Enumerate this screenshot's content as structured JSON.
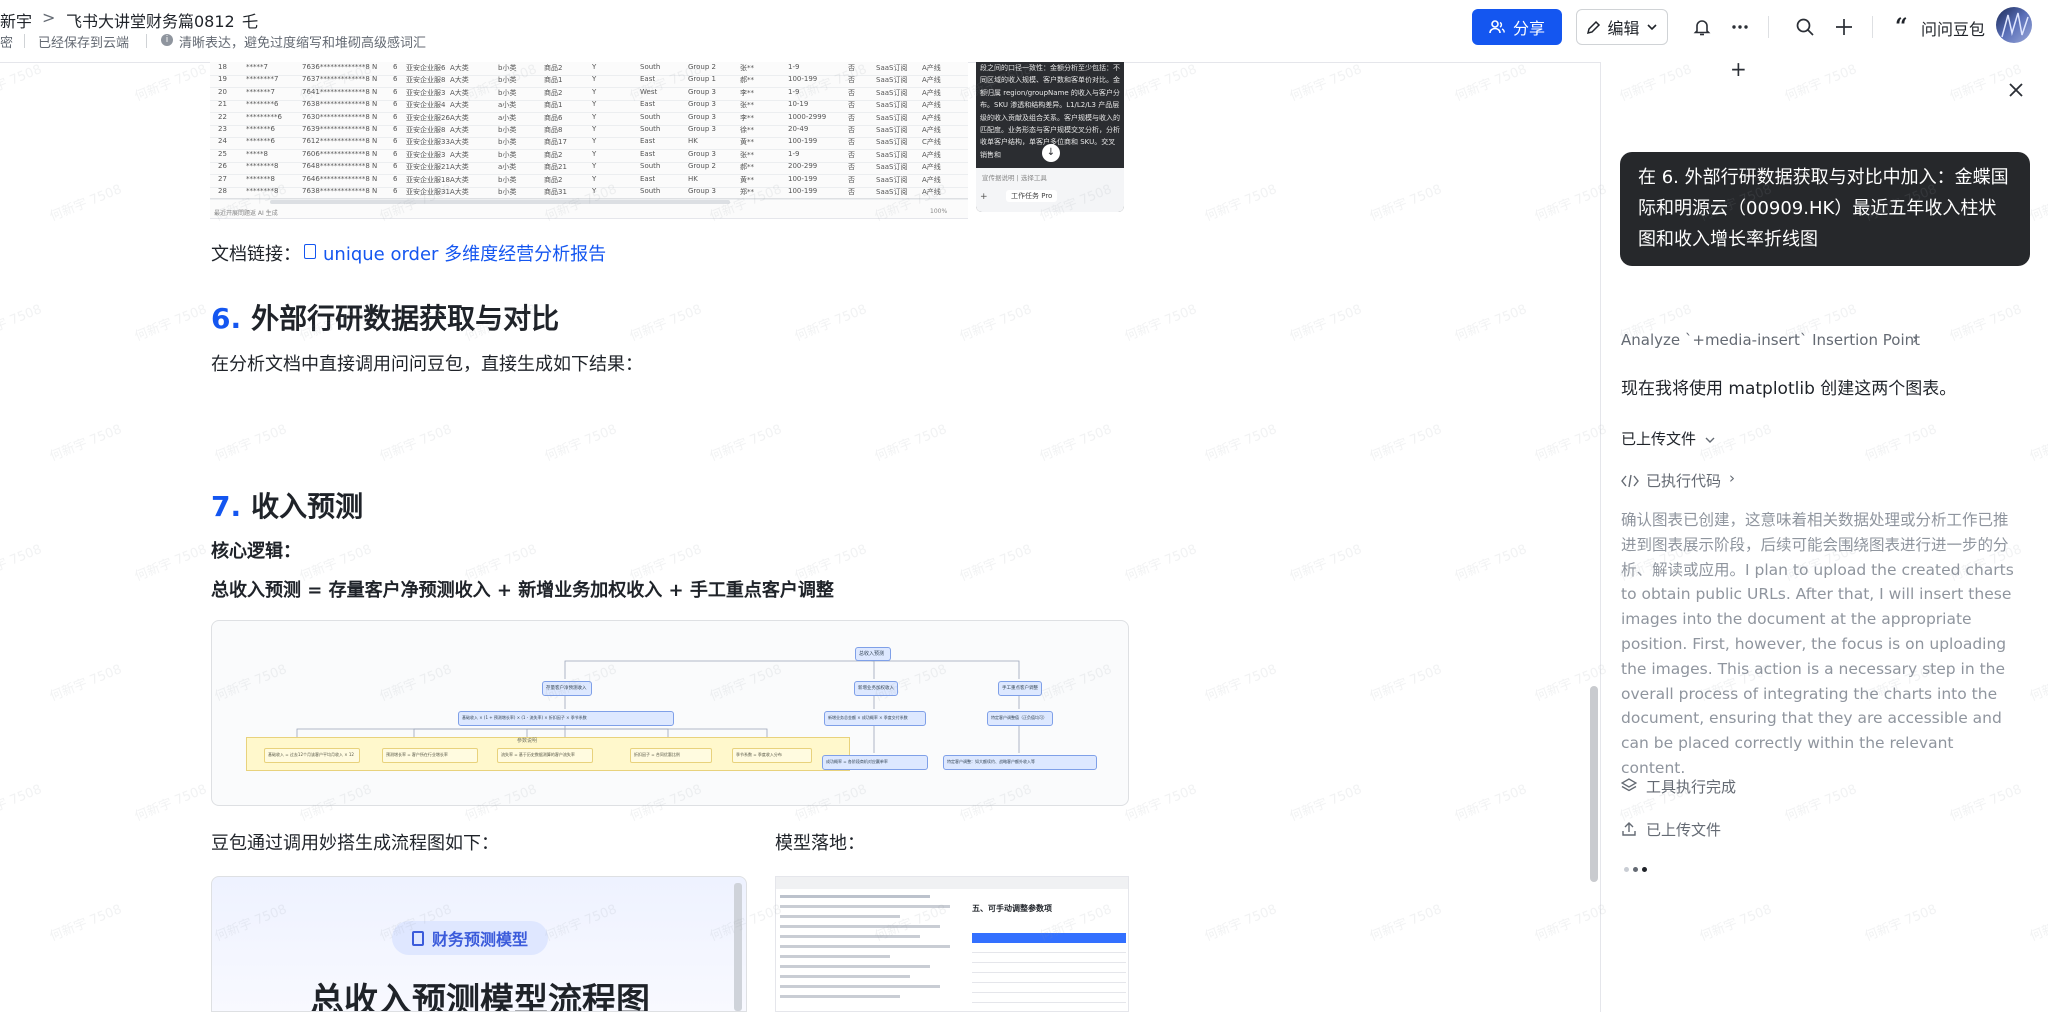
{
  "header": {
    "author": "新宇",
    "breadcrumb_sep": ">",
    "title": "飞书大讲堂财务篇0812",
    "pin_glyph": "乇",
    "sub_left": "密",
    "saved_status": "已经保存到云端",
    "tip_text": "清晰表达，避免过度缩写和堆砌高级感词汇",
    "share_label": "分享",
    "edit_label": "编辑",
    "ask_label": "问问豆包"
  },
  "document": {
    "link_prefix": "文档链接：",
    "link_text": "unique order 多维度经营分析报告",
    "section6_num": "6.",
    "section6_title": "外部行研数据获取与对比",
    "section6_body": "在分析文档中直接调用问问豆包，直接生成如下结果：",
    "section7_num": "7.",
    "section7_title": "收入预测",
    "core_logic_label": "核心逻辑：",
    "formula": "总收入预测 = 存量客户净预测收入 + 新增业务加权收入 + 手工重点客户调整",
    "caption_left": "豆包通过调用妙搭生成流程图如下：",
    "caption_right": "模型落地：",
    "card_badge": "财务预测模型",
    "card_title": "总收入预测模型流程图",
    "model_heading": "五、可手动调整参数项"
  },
  "sheet": {
    "rows": [
      [
        "18",
        "*****7",
        "7636*************8 N",
        "6",
        "亚安企业服6",
        "A大类",
        "b小类",
        "商品2",
        "Y",
        "South",
        "Group 2",
        "张**",
        "1-9",
        "否",
        "SaaS订阅",
        "A产线"
      ],
      [
        "19",
        "********7",
        "7637*************8 N",
        "6",
        "亚安企业服8",
        "A大类",
        "b小类",
        "商品1",
        "Y",
        "East",
        "Group 1",
        "郝**",
        "100-199",
        "否",
        "SaaS订阅",
        "A产线"
      ],
      [
        "20",
        "*******7",
        "7641*************8 N",
        "6",
        "亚安企业服3",
        "A大类",
        "b小类",
        "商品2",
        "Y",
        "West",
        "Group 3",
        "李**",
        "1-9",
        "否",
        "SaaS订阅",
        "A产线"
      ],
      [
        "21",
        "********6",
        "7638*************8 N",
        "6",
        "亚安企业服4",
        "A大类",
        "a小类",
        "商品1",
        "Y",
        "East",
        "Group 3",
        "张**",
        "10-19",
        "否",
        "SaaS订阅",
        "A产线"
      ],
      [
        "22",
        "*********6",
        "7630*************8 N",
        "6",
        "亚安企业服26",
        "A大类",
        "a小类",
        "商品6",
        "Y",
        "South",
        "Group 3",
        "李**",
        "1000-2999",
        "否",
        "SaaS订阅",
        "A产线"
      ],
      [
        "23",
        "*******6",
        "7639*************8 N",
        "6",
        "亚安企业服8",
        "A大类",
        "b小类",
        "商品8",
        "Y",
        "South",
        "Group 3",
        "徐**",
        "20-49",
        "否",
        "SaaS订阅",
        "A产线"
      ],
      [
        "24",
        "*******6",
        "7612*************8 N",
        "6",
        "亚安企业服33",
        "A大类",
        "b小类",
        "商品17",
        "Y",
        "East",
        "HK",
        "黄**",
        "100-199",
        "否",
        "SaaS订阅",
        "C产线"
      ],
      [
        "25",
        "*****8",
        "7606*************8 N",
        "6",
        "亚安企业服3",
        "A大类",
        "b小类",
        "商品2",
        "Y",
        "East",
        "Group 3",
        "张**",
        "1-9",
        "否",
        "SaaS订阅",
        "A产线"
      ],
      [
        "26",
        "********8",
        "7648*************8 N",
        "6",
        "亚安企业服21",
        "A大类",
        "a小类",
        "商品21",
        "Y",
        "South",
        "Group 2",
        "郝**",
        "200-299",
        "否",
        "SaaS订阅",
        "A产线"
      ],
      [
        "27",
        "*******8",
        "7646*************8 N",
        "6",
        "亚安企业服18",
        "A大类",
        "b小类",
        "商品2",
        "Y",
        "East",
        "HK",
        "黄**",
        "100-199",
        "否",
        "SaaS订阅",
        "A产线"
      ],
      [
        "28",
        "********8",
        "7638*************8 N",
        "6",
        "亚安企业服31",
        "A大类",
        "b小类",
        "商品31",
        "Y",
        "South",
        "Group 3",
        "郑**",
        "100-199",
        "否",
        "SaaS订阅",
        "A产线"
      ]
    ],
    "status_text": "最近开展問題返 AI 生成",
    "zoom": "100%",
    "popup_text": "段之间的口径一致性：金额分析至少包括：不同区域的收入规模、客户数和客单价对比。金额归属 region/groupName 的收入与客户分布。SKU 渗透和结构差异。L1/L2/L3 产品层级的收入贡献及组合关系。客户规模与收入的匹配度。业务形态与客户规模交叉分析，分析收单客户结构，单客户多位商和 SKU。交叉销售和",
    "popup_footer": "宣传据说明 | 选择工具",
    "popup_tool": "工作任务 Pro"
  },
  "flow": {
    "root": "总收入预测",
    "branch1": "存量客户净预测收入",
    "branch2": "新增业务加权收入",
    "branch3": "手工重点客户调整",
    "mid1": "基础收入 × (1 + 预测增长率) × (1 - 流失率) × 折扣因子 × 季节系数",
    "mid2": "新增业务总金额 × 成功概率 × 季度交付系数",
    "mid3": "特定客户调整值（正负值均可）",
    "group_label": "参数说明",
    "leaf1": "基础收入 = 过去12个月该客户平均月收入 × 12",
    "leaf2": "预测增长率 = 客户所在行业增长率",
    "leaf3": "流失率 = 基于历史数据测算的客户流失率",
    "leaf4": "折扣因子 = 合同优惠比例",
    "leaf5": "季节系数 = 季度收入分布",
    "leaf6": "成功概率 = 各阶段商机对应赢单率",
    "leaf7": "特定客户调整：如大额续约、战略客户额外收入等"
  },
  "panel": {
    "user_message": "在 6. 外部行研数据获取与对比中加入：金蝶国际和明源云（00909.HK）最近五年收入柱状图和收入增长率折线图",
    "analyze_label": "Analyze `+media-insert` Insertion Point",
    "reply": "现在我将使用 matplotlib 创建这两个图表。",
    "uploaded_toggle": "已上传文件",
    "executed_code": "已执行代码",
    "thinking": "确认图表已创建，这意味着相关数据处理或分析工作已推进到图表展示阶段，后续可能会围绕图表进行进一步的分析、解读或应用。I plan to upload the created charts to obtain public URLs. After that, I will insert these images into the document at the appropriate position. First, however, the focus is on uploading the images. This action is a necessary step in the overall process of integrating the charts into the document, ensuring that they are accessible and can be placed correctly within the relevant content.",
    "tool_done": "工具执行完成",
    "uploaded_file": "已上传文件"
  },
  "watermark": "何新宇 7508",
  "colors": {
    "accent": "#1456f0",
    "bubble": "#26282b",
    "muted": "#8f959e"
  }
}
